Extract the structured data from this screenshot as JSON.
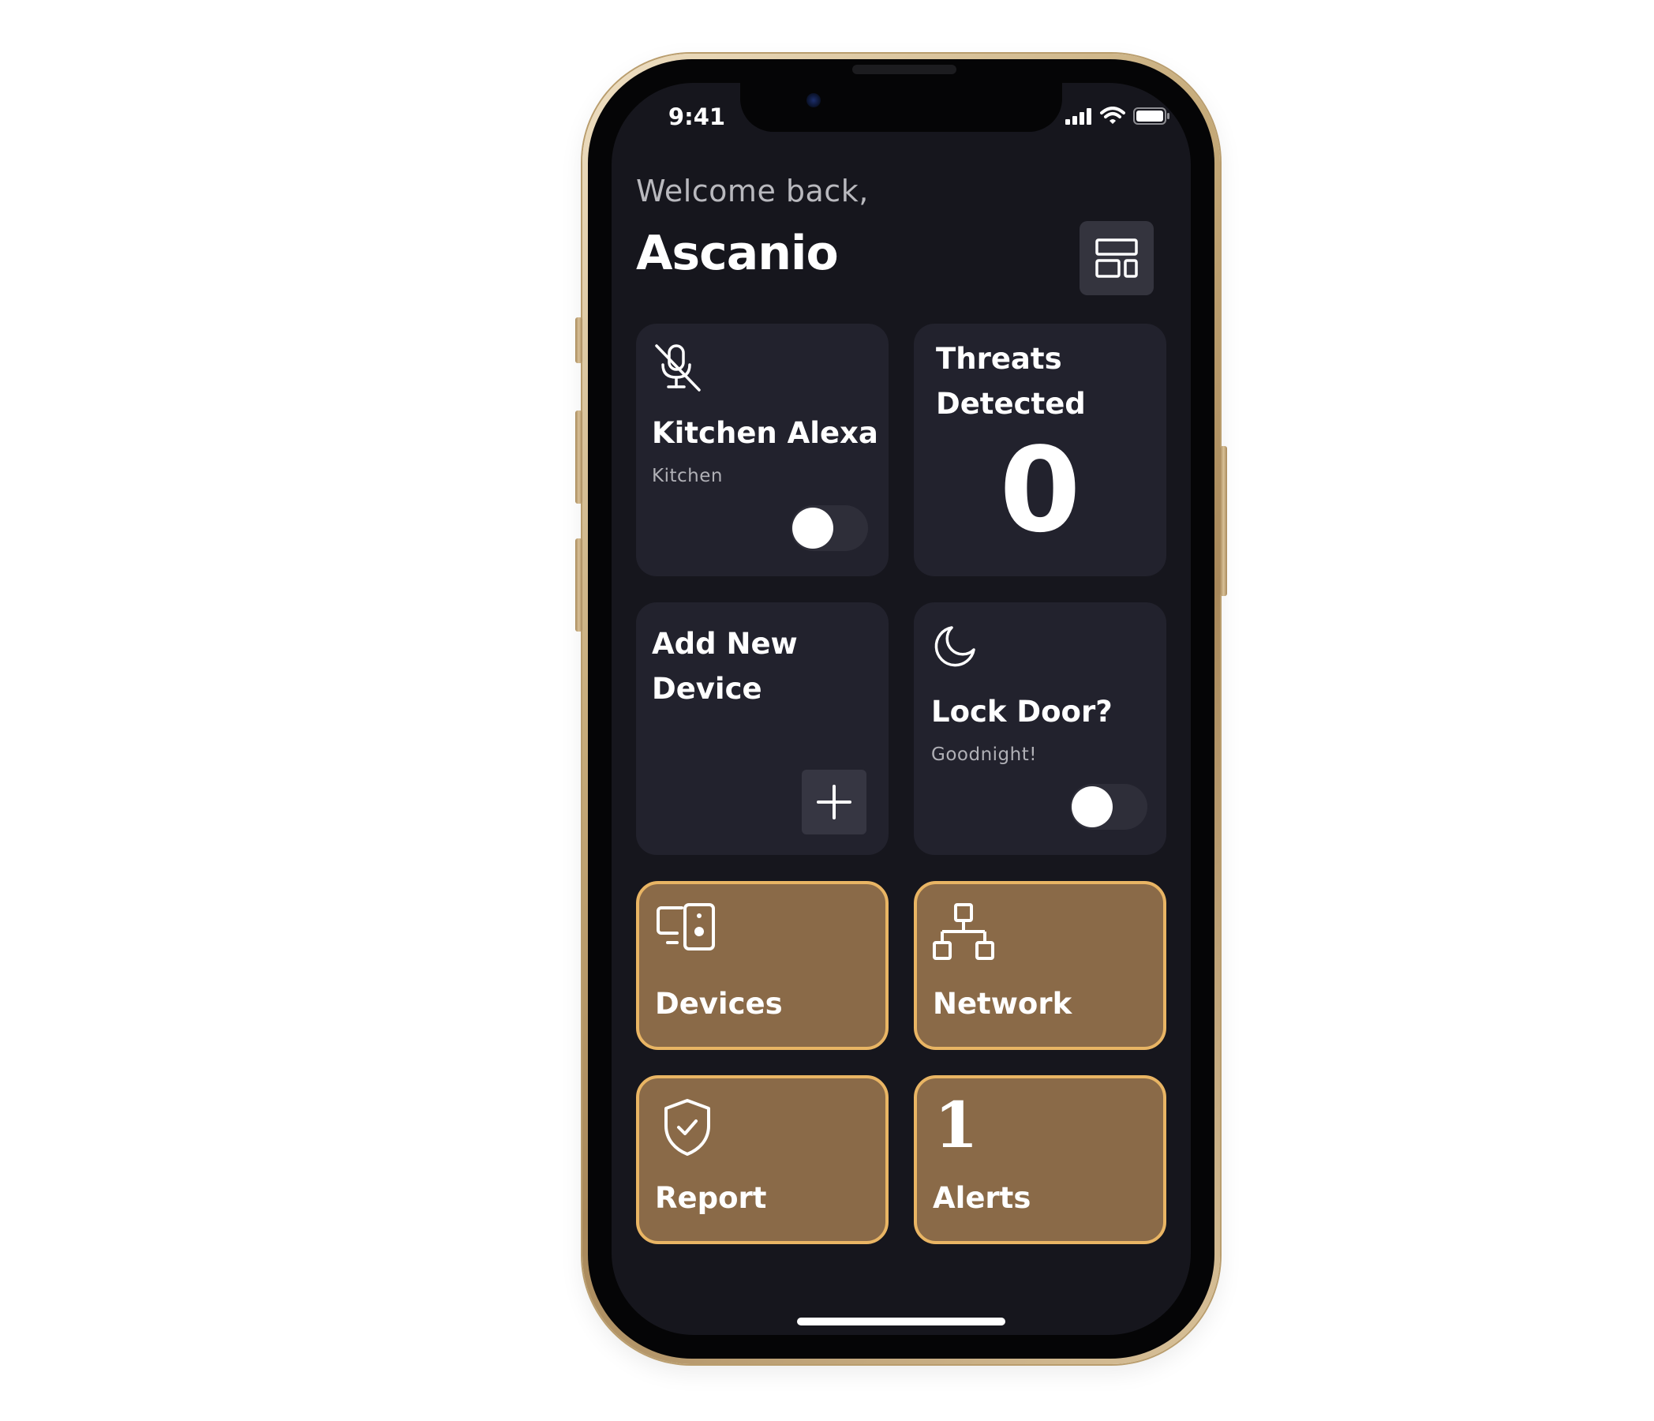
{
  "status_bar": {
    "time": "9:41"
  },
  "header": {
    "greeting": "Welcome back,",
    "user_name": "Ascanio"
  },
  "cards": {
    "kitchen_alexa": {
      "title": "Kitchen Alexa",
      "room": "Kitchen",
      "enabled": false
    },
    "threats": {
      "title_line1": "Threats",
      "title_line2": "Detected",
      "count": "0"
    },
    "add_device": {
      "title_line1": "Add New",
      "title_line2": "Device"
    },
    "lock_door": {
      "title": "Lock Door?",
      "subtitle": "Goodnight!",
      "enabled": false
    }
  },
  "nav_tiles": {
    "devices": {
      "label": "Devices",
      "icon": "devices-icon"
    },
    "network": {
      "label": "Network",
      "icon": "network-icon"
    },
    "report": {
      "label": "Report",
      "icon": "shield-check-icon"
    },
    "alerts": {
      "label": "Alerts",
      "count": "1"
    }
  },
  "colors": {
    "background": "#16161d",
    "card": "#22222d",
    "tile_fill": "#8a6a48",
    "tile_border": "#e9b564",
    "text": "#ffffff",
    "muted_text": "#b0b0b6"
  }
}
